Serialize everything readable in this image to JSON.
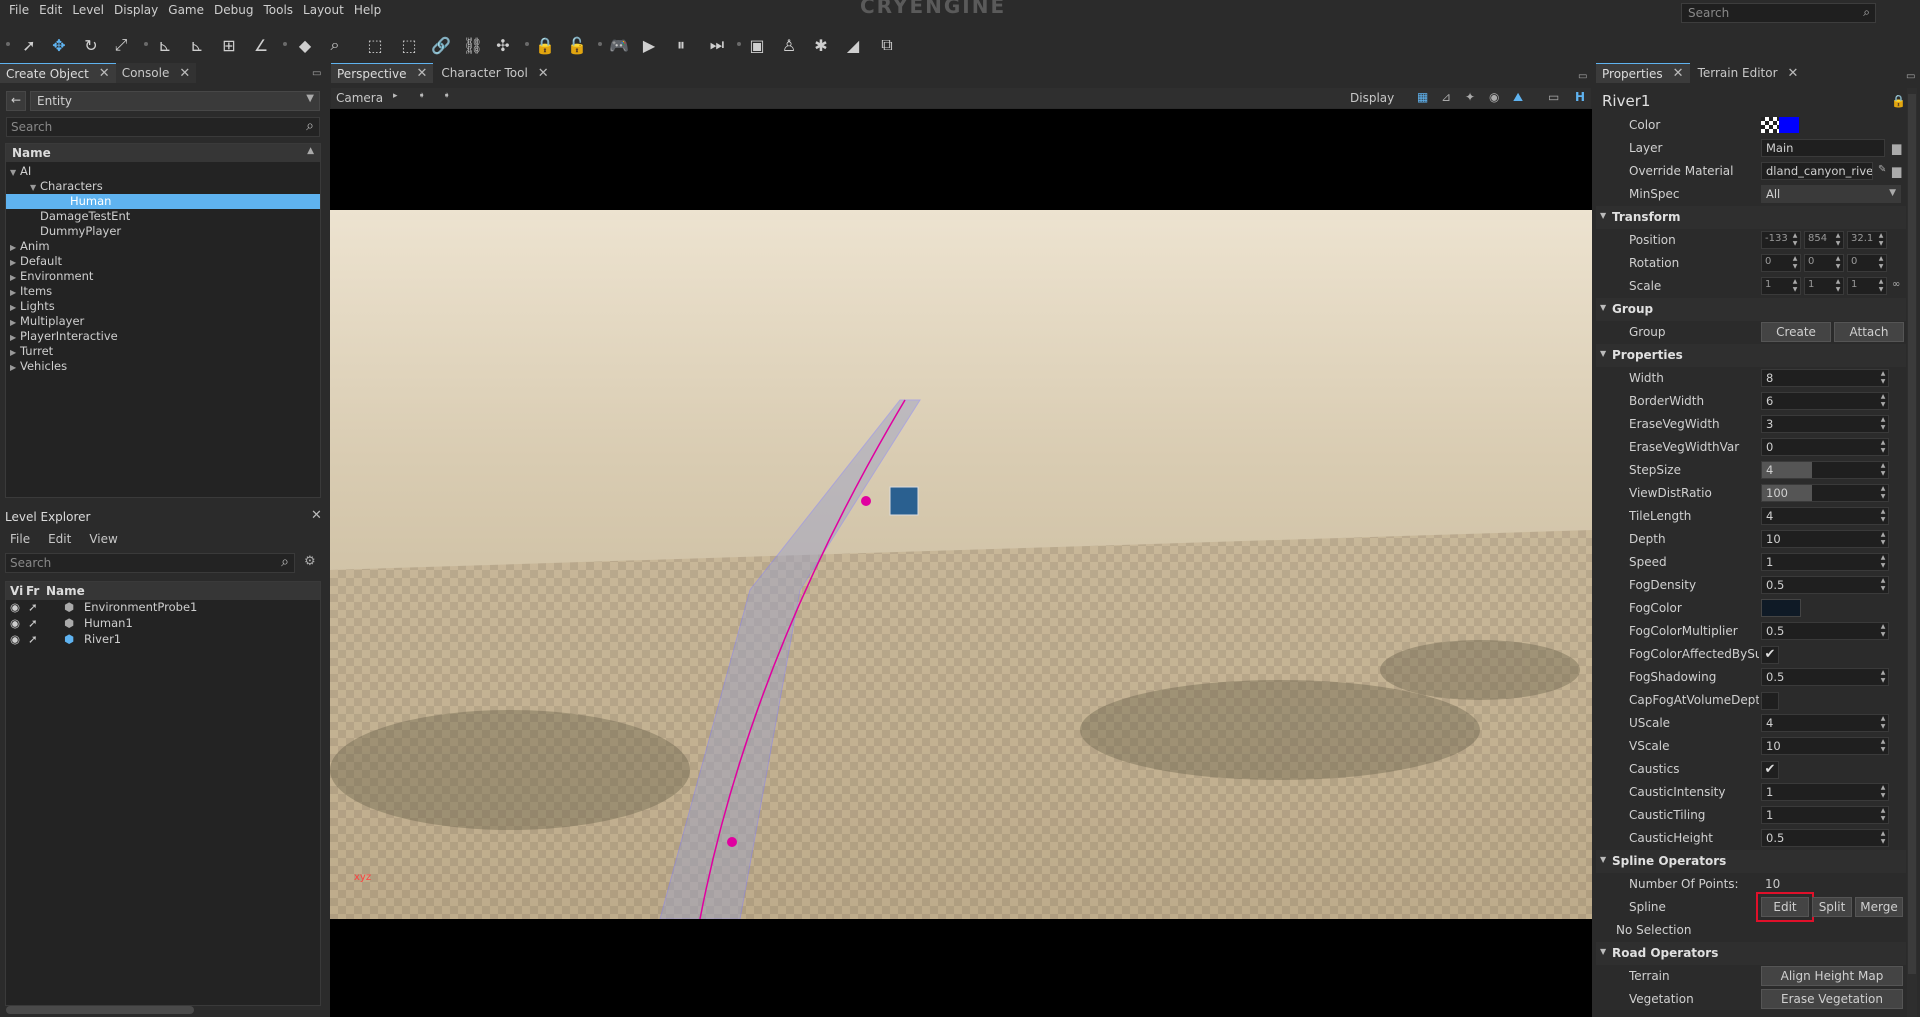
{
  "menu": [
    "File",
    "Edit",
    "Level",
    "Display",
    "Game",
    "Debug",
    "Tools",
    "Layout",
    "Help"
  ],
  "logo": "CRYENGINE",
  "global_search": {
    "placeholder": "Search"
  },
  "left_top": {
    "tabs": [
      {
        "label": "Create Object"
      },
      {
        "label": "Console"
      }
    ],
    "category": "Entity",
    "search_placeholder": "Search",
    "column": "Name",
    "tree": [
      {
        "label": "AI",
        "depth": 0,
        "expanded": true
      },
      {
        "label": "Characters",
        "depth": 1,
        "expanded": true
      },
      {
        "label": "Human",
        "depth": 2,
        "selected": true
      },
      {
        "label": "DamageTestEnt",
        "depth": 1
      },
      {
        "label": "DummyPlayer",
        "depth": 1
      },
      {
        "label": "Anim",
        "depth": 0
      },
      {
        "label": "Default",
        "depth": 0
      },
      {
        "label": "Environment",
        "depth": 0
      },
      {
        "label": "Items",
        "depth": 0
      },
      {
        "label": "Lights",
        "depth": 0
      },
      {
        "label": "Multiplayer",
        "depth": 0
      },
      {
        "label": "PlayerInteractive",
        "depth": 0
      },
      {
        "label": "Turret",
        "depth": 0
      },
      {
        "label": "Vehicles",
        "depth": 0
      }
    ]
  },
  "level_explorer": {
    "title": "Level Explorer",
    "menu": [
      "File",
      "Edit",
      "View"
    ],
    "search_placeholder": "Search",
    "columns": [
      "Vi",
      "Fr",
      "Name"
    ],
    "rows": [
      {
        "name": "EnvironmentProbe1"
      },
      {
        "name": "Human1"
      },
      {
        "name": "River1"
      }
    ]
  },
  "center": {
    "tabs": [
      {
        "label": "Perspective"
      },
      {
        "label": "Character Tool"
      }
    ],
    "camera_label": "Camera",
    "display_label": "Display",
    "h_label": "H"
  },
  "right": {
    "tabs": [
      {
        "label": "Properties"
      },
      {
        "label": "Terrain Editor"
      }
    ],
    "object_name": "River1",
    "color_swatch": "#0000ff",
    "fog_color": "#0f1a26",
    "rows_top": [
      {
        "label": "Color"
      },
      {
        "label": "Layer",
        "value": "Main"
      },
      {
        "label": "Override Material",
        "value": "dland_canyon_river"
      },
      {
        "label": "MinSpec",
        "value": "All"
      }
    ],
    "transform": {
      "title": "Transform",
      "position": {
        "label": "Position",
        "values": [
          "-133",
          "854",
          "32.1"
        ]
      },
      "rotation": {
        "label": "Rotation",
        "values": [
          "0",
          "0",
          "0"
        ]
      },
      "scale": {
        "label": "Scale",
        "values": [
          "1",
          "1",
          "1"
        ]
      }
    },
    "group": {
      "title": "Group",
      "label": "Group",
      "create": "Create",
      "attach": "Attach"
    },
    "properties_title": "Properties",
    "properties": [
      {
        "label": "Width",
        "value": "8"
      },
      {
        "label": "BorderWidth",
        "value": "6"
      },
      {
        "label": "EraseVegWidth",
        "value": "3"
      },
      {
        "label": "EraseVegWidthVar",
        "value": "0"
      },
      {
        "label": "StepSize",
        "value": "4"
      },
      {
        "label": "ViewDistRatio",
        "value": "100"
      },
      {
        "label": "TileLength",
        "value": "4"
      },
      {
        "label": "Depth",
        "value": "10"
      },
      {
        "label": "Speed",
        "value": "1"
      },
      {
        "label": "FogDensity",
        "value": "0.5"
      },
      {
        "label": "FogColor",
        "value": ""
      },
      {
        "label": "FogColorMultiplier",
        "value": "0.5"
      },
      {
        "label": "FogColorAffectedBySu",
        "value": "✔"
      },
      {
        "label": "FogShadowing",
        "value": "0.5"
      },
      {
        "label": "CapFogAtVolumeDept",
        "value": ""
      },
      {
        "label": "UScale",
        "value": "4"
      },
      {
        "label": "VScale",
        "value": "10"
      },
      {
        "label": "Caustics",
        "value": "✔"
      },
      {
        "label": "CausticIntensity",
        "value": "1"
      },
      {
        "label": "CausticTiling",
        "value": "1"
      },
      {
        "label": "CausticHeight",
        "value": "0.5"
      }
    ],
    "spline_ops": {
      "title": "Spline Operators",
      "points_label": "Number Of Points:",
      "points": "10",
      "spline_label": "Spline",
      "edit": "Edit",
      "split": "Split",
      "merge": "Merge",
      "no_selection": "No Selection"
    },
    "road_ops": {
      "title": "Road Operators",
      "terrain_label": "Terrain",
      "terrain_btn": "Align Height Map",
      "veg_label": "Vegetation",
      "veg_btn": "Erase Vegetation"
    }
  }
}
